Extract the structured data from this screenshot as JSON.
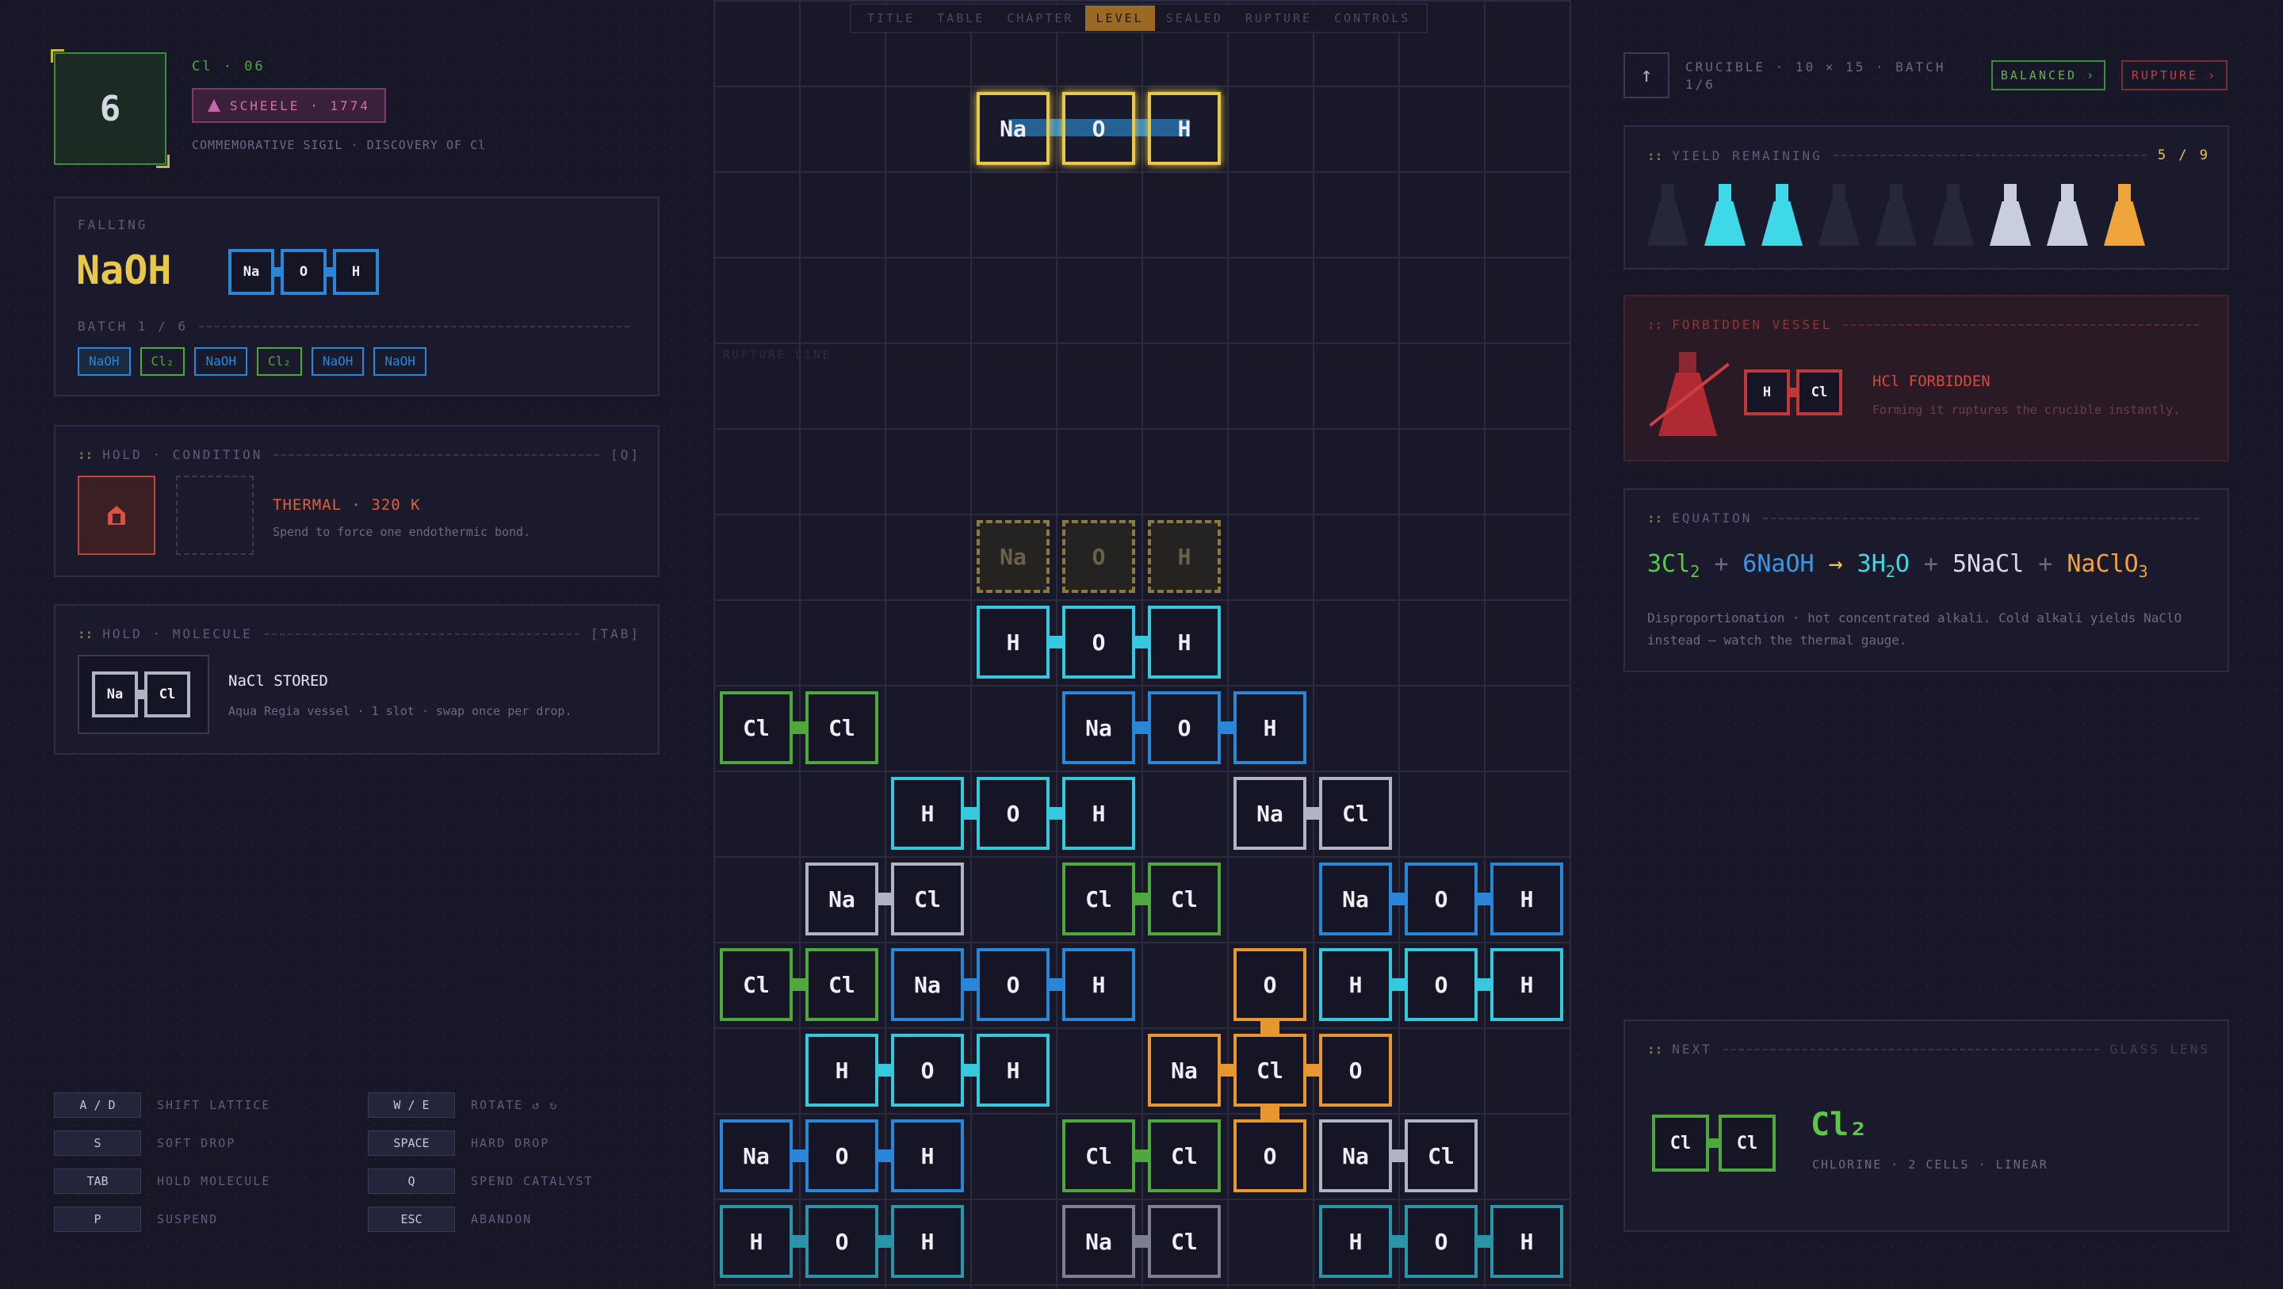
{
  "tabs": [
    "TITLE",
    "TABLE",
    "CHAPTER",
    "LEVEL",
    "SEALED",
    "RUPTURE",
    "CONTROLS"
  ],
  "active_tab": "LEVEL",
  "sigil": {
    "number": "6",
    "element_line": "Cl · 06",
    "badge": "SCHEELE · 1774",
    "caption": "COMMEMORATIVE SIGIL · DISCOVERY OF Cl"
  },
  "falling": {
    "label": "FALLING",
    "formula": "NaOH",
    "atoms": [
      "Na",
      "O",
      "H"
    ],
    "batch_label": "BATCH 1 / 6",
    "queue": [
      {
        "label": "NaOH",
        "color": "#2a86d6"
      },
      {
        "label": "Cl₂",
        "color": "#4ea83c"
      },
      {
        "label": "NaOH",
        "color": "#2a86d6"
      },
      {
        "label": "Cl₂",
        "color": "#4ea83c"
      },
      {
        "label": "NaOH",
        "color": "#2a86d6"
      },
      {
        "label": "NaOH",
        "color": "#2a86d6"
      }
    ]
  },
  "hold_condition": {
    "title": "HOLD · CONDITION",
    "key": "[Q]",
    "name": "THERMAL · 320 K",
    "desc": "Spend to force one endothermic bond.",
    "icon": "flame-icon"
  },
  "hold_molecule": {
    "title": "HOLD · MOLECULE",
    "key": "[TAB]",
    "atoms": [
      "Na",
      "Cl"
    ],
    "name": "NaCl STORED",
    "desc": "Aqua Regia vessel · 1 slot · swap once per drop."
  },
  "controls": [
    {
      "key": "A / D",
      "label": "SHIFT LATTICE"
    },
    {
      "key": "W / E",
      "label": "ROTATE ↺ ↻"
    },
    {
      "key": "S",
      "label": "SOFT DROP"
    },
    {
      "key": "SPACE",
      "label": "HARD DROP"
    },
    {
      "key": "TAB",
      "label": "HOLD MOLECULE"
    },
    {
      "key": "Q",
      "label": "SPEND CATALYST"
    },
    {
      "key": "P",
      "label": "SUSPEND"
    },
    {
      "key": "ESC",
      "label": "ABANDON"
    }
  ],
  "board": {
    "rupture_label": "RUPTURE LINE",
    "falling_piece": [
      "Na",
      "O",
      "H"
    ],
    "ghost_piece": [
      "Na",
      "O",
      "H"
    ],
    "cells": [
      {
        "c": 3,
        "r": 7,
        "t": "H",
        "k": "cyan"
      },
      {
        "c": 4,
        "r": 7,
        "t": "O",
        "k": "cyan"
      },
      {
        "c": 5,
        "r": 7,
        "t": "H",
        "k": "cyan"
      },
      {
        "c": 0,
        "r": 8,
        "t": "Cl",
        "k": "green"
      },
      {
        "c": 1,
        "r": 8,
        "t": "Cl",
        "k": "green"
      },
      {
        "c": 4,
        "r": 8,
        "t": "Na",
        "k": "blue"
      },
      {
        "c": 5,
        "r": 8,
        "t": "O",
        "k": "blue"
      },
      {
        "c": 6,
        "r": 8,
        "t": "H",
        "k": "blue"
      },
      {
        "c": 2,
        "r": 9,
        "t": "H",
        "k": "cyan"
      },
      {
        "c": 3,
        "r": 9,
        "t": "O",
        "k": "cyan"
      },
      {
        "c": 4,
        "r": 9,
        "t": "H",
        "k": "cyan"
      },
      {
        "c": 6,
        "r": 9,
        "t": "Na",
        "k": "silver"
      },
      {
        "c": 7,
        "r": 9,
        "t": "Cl",
        "k": "silver"
      },
      {
        "c": 1,
        "r": 10,
        "t": "Na",
        "k": "silver"
      },
      {
        "c": 2,
        "r": 10,
        "t": "Cl",
        "k": "silver"
      },
      {
        "c": 4,
        "r": 10,
        "t": "Cl",
        "k": "green"
      },
      {
        "c": 5,
        "r": 10,
        "t": "Cl",
        "k": "green"
      },
      {
        "c": 7,
        "r": 10,
        "t": "Na",
        "k": "blue"
      },
      {
        "c": 8,
        "r": 10,
        "t": "O",
        "k": "blue"
      },
      {
        "c": 9,
        "r": 10,
        "t": "H",
        "k": "blue"
      },
      {
        "c": 0,
        "r": 11,
        "t": "Cl",
        "k": "green"
      },
      {
        "c": 1,
        "r": 11,
        "t": "Cl",
        "k": "green"
      },
      {
        "c": 2,
        "r": 11,
        "t": "Na",
        "k": "blue"
      },
      {
        "c": 3,
        "r": 11,
        "t": "O",
        "k": "blue"
      },
      {
        "c": 4,
        "r": 11,
        "t": "H",
        "k": "blue"
      },
      {
        "c": 6,
        "r": 11,
        "t": "O",
        "k": "orange"
      },
      {
        "c": 7,
        "r": 11,
        "t": "H",
        "k": "cyan"
      },
      {
        "c": 8,
        "r": 11,
        "t": "O",
        "k": "cyan"
      },
      {
        "c": 9,
        "r": 11,
        "t": "H",
        "k": "cyan"
      },
      {
        "c": 1,
        "r": 12,
        "t": "H",
        "k": "cyan"
      },
      {
        "c": 2,
        "r": 12,
        "t": "O",
        "k": "cyan"
      },
      {
        "c": 3,
        "r": 12,
        "t": "H",
        "k": "cyan"
      },
      {
        "c": 5,
        "r": 12,
        "t": "Na",
        "k": "orange"
      },
      {
        "c": 6,
        "r": 12,
        "t": "Cl",
        "k": "orange"
      },
      {
        "c": 7,
        "r": 12,
        "t": "O",
        "k": "orange"
      },
      {
        "c": 0,
        "r": 13,
        "t": "Na",
        "k": "blue"
      },
      {
        "c": 1,
        "r": 13,
        "t": "O",
        "k": "blue"
      },
      {
        "c": 2,
        "r": 13,
        "t": "H",
        "k": "blue"
      },
      {
        "c": 4,
        "r": 13,
        "t": "Cl",
        "k": "green"
      },
      {
        "c": 5,
        "r": 13,
        "t": "Cl",
        "k": "green"
      },
      {
        "c": 6,
        "r": 13,
        "t": "O",
        "k": "orange"
      },
      {
        "c": 7,
        "r": 13,
        "t": "Na",
        "k": "silver"
      },
      {
        "c": 8,
        "r": 13,
        "t": "Cl",
        "k": "silver"
      },
      {
        "c": 0,
        "r": 14,
        "t": "H",
        "k": "teal"
      },
      {
        "c": 1,
        "r": 14,
        "t": "O",
        "k": "teal"
      },
      {
        "c": 2,
        "r": 14,
        "t": "H",
        "k": "teal"
      },
      {
        "c": 4,
        "r": 14,
        "t": "Na",
        "k": "gray"
      },
      {
        "c": 5,
        "r": 14,
        "t": "Cl",
        "k": "gray"
      },
      {
        "c": 7,
        "r": 14,
        "t": "H",
        "k": "teal"
      },
      {
        "c": 8,
        "r": 14,
        "t": "O",
        "k": "teal"
      },
      {
        "c": 9,
        "r": 14,
        "t": "H",
        "k": "teal"
      }
    ],
    "hbonds": [
      [
        3,
        7
      ],
      [
        4,
        7
      ],
      [
        0,
        8
      ],
      [
        4,
        8
      ],
      [
        5,
        8
      ],
      [
        2,
        9
      ],
      [
        3,
        9
      ],
      [
        6,
        9
      ],
      [
        1,
        10
      ],
      [
        4,
        10
      ],
      [
        7,
        10
      ],
      [
        8,
        10
      ],
      [
        0,
        11
      ],
      [
        2,
        11
      ],
      [
        3,
        11
      ],
      [
        7,
        11
      ],
      [
        8,
        11
      ],
      [
        1,
        12
      ],
      [
        2,
        12
      ],
      [
        5,
        12
      ],
      [
        6,
        12
      ],
      [
        0,
        13
      ],
      [
        1,
        13
      ],
      [
        4,
        13
      ],
      [
        7,
        13
      ],
      [
        0,
        14
      ],
      [
        1,
        14
      ],
      [
        4,
        14
      ],
      [
        7,
        14
      ],
      [
        8,
        14
      ]
    ],
    "vbonds": [
      [
        6,
        11
      ],
      [
        6,
        12
      ]
    ]
  },
  "crucible": {
    "title": "CRUCIBLE · 10 × 15 · BATCH 1/6",
    "balanced": "BALANCED ›",
    "rupture": "RUPTURE ›",
    "arrow_icon": "up-arrow-icon"
  },
  "yield": {
    "title": "YIELD REMAINING",
    "count": "5 / 9",
    "flasks": [
      {
        "color": "#262838",
        "filled": false
      },
      {
        "color": "#3ed8e8",
        "filled": true
      },
      {
        "color": "#3ed8e8",
        "filled": true
      },
      {
        "color": "#262838",
        "filled": false
      },
      {
        "color": "#262838",
        "filled": false
      },
      {
        "color": "#262838",
        "filled": false
      },
      {
        "color": "#c8cede",
        "filled": true
      },
      {
        "color": "#c8cede",
        "filled": true
      },
      {
        "color": "#f0a43c",
        "filled": true
      }
    ]
  },
  "forbidden": {
    "title": "FORBIDDEN VESSEL",
    "atoms": [
      "H",
      "Cl"
    ],
    "name": "HCl FORBIDDEN",
    "desc": "Forming it ruptures the crucible instantly."
  },
  "equation": {
    "title": "EQUATION",
    "terms": [
      {
        "text": "3Cl",
        "sub": "2",
        "color": "#5cc848"
      },
      {
        "text": "+",
        "sub": "",
        "color": "#6a6a88"
      },
      {
        "text": "6NaOH",
        "sub": "",
        "color": "#3a98e8"
      },
      {
        "text": "→",
        "sub": "",
        "color": "#f0c83c"
      },
      {
        "text": "3H",
        "sub": "2",
        "tail": "O",
        "color": "#3ed8e8"
      },
      {
        "text": "+",
        "sub": "",
        "color": "#6a6a88"
      },
      {
        "text": "5NaCl",
        "sub": "",
        "color": "#d8dae4"
      },
      {
        "text": "+",
        "sub": "",
        "color": "#6a6a88"
      },
      {
        "text": "NaClO",
        "sub": "3",
        "color": "#f0a43c"
      }
    ],
    "desc1": "Disproportionation · hot concentrated alkali. Cold alkali yields NaClO",
    "desc2": "instead — watch the thermal gauge."
  },
  "next": {
    "title": "NEXT",
    "lens": "GLASS LENS",
    "atoms": [
      "Cl",
      "Cl"
    ],
    "formula": "Cl₂",
    "desc": "CHLORINE · 2 CELLS · LINEAR"
  },
  "colors": {
    "cyan": "#36c8dc",
    "blue": "#2a86d6",
    "green": "#4ea83c",
    "silver": "#b0b4c4",
    "orange": "#e8962e",
    "teal": "#2a94a8",
    "gray": "#7e8092",
    "gold": "#e8c84a",
    "red": "#c03838"
  }
}
